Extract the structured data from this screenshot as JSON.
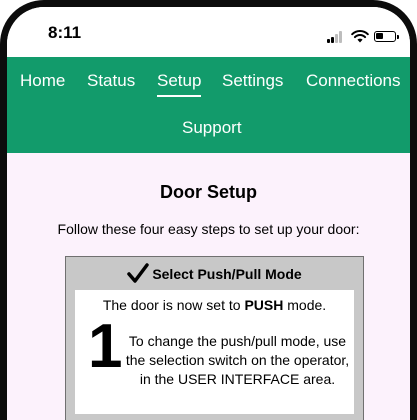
{
  "status_bar": {
    "time": "8:11"
  },
  "nav": {
    "items": [
      {
        "label": "Home",
        "active": false
      },
      {
        "label": "Status",
        "active": false
      },
      {
        "label": "Setup",
        "active": true
      },
      {
        "label": "Settings",
        "active": false
      },
      {
        "label": "Connections",
        "active": false
      },
      {
        "label": "Support",
        "active": false
      }
    ]
  },
  "page": {
    "title": "Door Setup",
    "intro": "Follow these four easy steps to set up your door:"
  },
  "step": {
    "header": "Select Push/Pull Mode",
    "mode_prefix": "The door is now set to",
    "mode_value": "PUSH",
    "mode_suffix": "mode.",
    "number": "1",
    "instructions": "To change the push/pull mode, use the selection switch on the operator, in the USER INTERFACE area."
  },
  "colors": {
    "nav_background": "#129b6b",
    "content_background": "#fcf2fc",
    "card_background": "#c8c8c8"
  },
  "icons": [
    "signal-icon",
    "wifi-icon",
    "battery-icon",
    "checkmark-icon"
  ]
}
